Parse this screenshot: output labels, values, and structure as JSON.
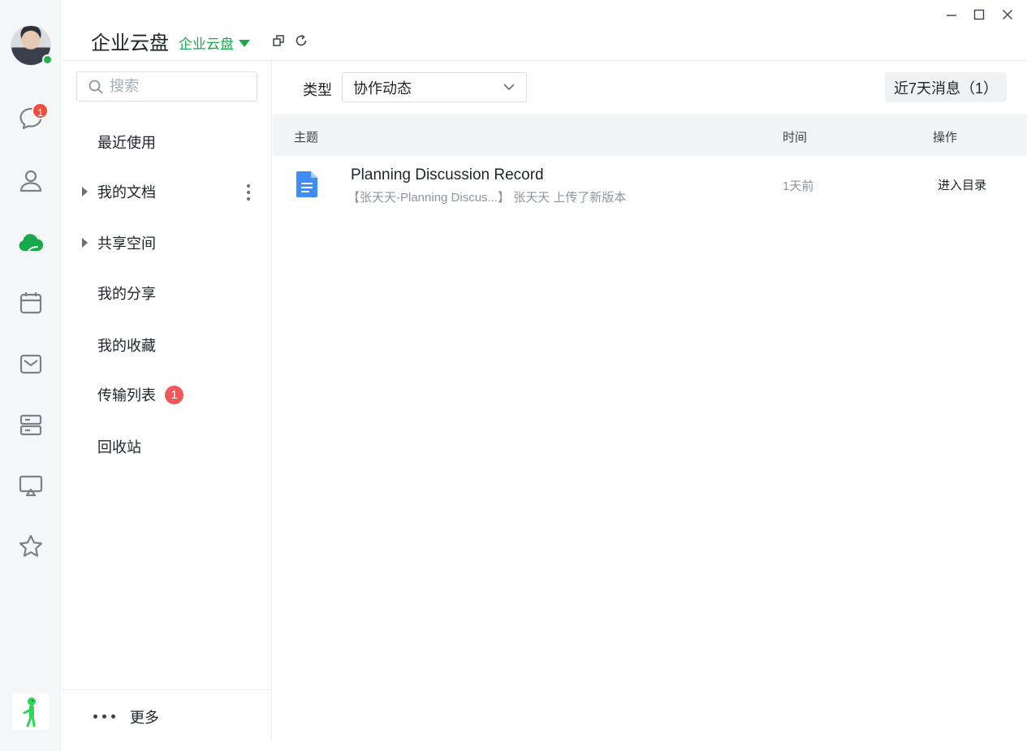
{
  "app": {
    "title": "企业云盘",
    "space_name": "企业云盘"
  },
  "rail": {
    "items": [
      {
        "icon": "chat-bubble-icon",
        "badge": "1"
      },
      {
        "icon": "contacts-icon"
      },
      {
        "icon": "cloud-drive-icon",
        "active": true
      },
      {
        "icon": "calendar-icon"
      },
      {
        "icon": "mail-icon"
      },
      {
        "icon": "server-storage-icon"
      },
      {
        "icon": "screen-share-icon"
      },
      {
        "icon": "star-icon"
      }
    ],
    "accent_color": "#18a94b"
  },
  "search": {
    "placeholder": "搜索"
  },
  "nav": {
    "items": [
      {
        "label": "最近使用"
      },
      {
        "label": "我的文档",
        "expandable": true
      },
      {
        "label": "共享空间",
        "expandable": true
      },
      {
        "label": "我的分享"
      },
      {
        "label": "我的收藏"
      },
      {
        "label": "传输列表",
        "badge": "1"
      },
      {
        "label": "回收站"
      }
    ],
    "more_label": "更多"
  },
  "filter": {
    "type_label": "类型",
    "selected": "协作动态",
    "recent_button": "近7天消息（1）"
  },
  "table": {
    "columns": [
      "主题",
      "时间",
      "操作"
    ],
    "rows": [
      {
        "title": "Planning Discussion Record",
        "subtitle": "【张天天-Planning Discus...】 张天天 上传了新版本",
        "time": "1天前",
        "action": "进入目录",
        "icon": "document-icon"
      }
    ]
  }
}
